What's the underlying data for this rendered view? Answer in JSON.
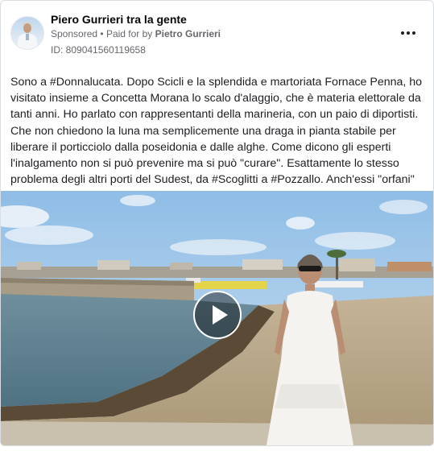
{
  "post": {
    "page_name": "Piero Gurrieri tra la gente",
    "sponsored_label": "Sponsored",
    "separator": "•",
    "paid_for_prefix": "Paid for by",
    "paid_for_by": "Pietro Gurrieri",
    "ad_id": "ID: 809041560119658",
    "more_icon": "ellipsis-icon",
    "body_text": "Sono a #Donnalucata. Dopo Scicli e la splendida e martoriata Fornace Penna, ho visitato insieme a Concetta Morana lo scalo d'alaggio, che è materia elettorale da tanti anni. Ho parlato con rappresentanti della marineria, con un paio di diportisti. Che non chiedono la luna ma semplicemente una draga in pianta stabile per liberare il porticciolo dalla poseidonia e dalle alghe. Come dicono gli esperti l'inalgamento non si può prevenire ma si può \"curare\". Esattamente lo stesso problema degli altri porti del Sudest, da #Scoglitti a #Pozzallo. Anch'essi \"orfani\" ..."
  },
  "media": {
    "type": "video",
    "play_icon": "play-icon"
  },
  "colors": {
    "sky": "#9ec6ea",
    "sea": "#5f8192",
    "sand": "#b9a78a",
    "secondary_text": "#65676b",
    "border": "#dadde1"
  }
}
